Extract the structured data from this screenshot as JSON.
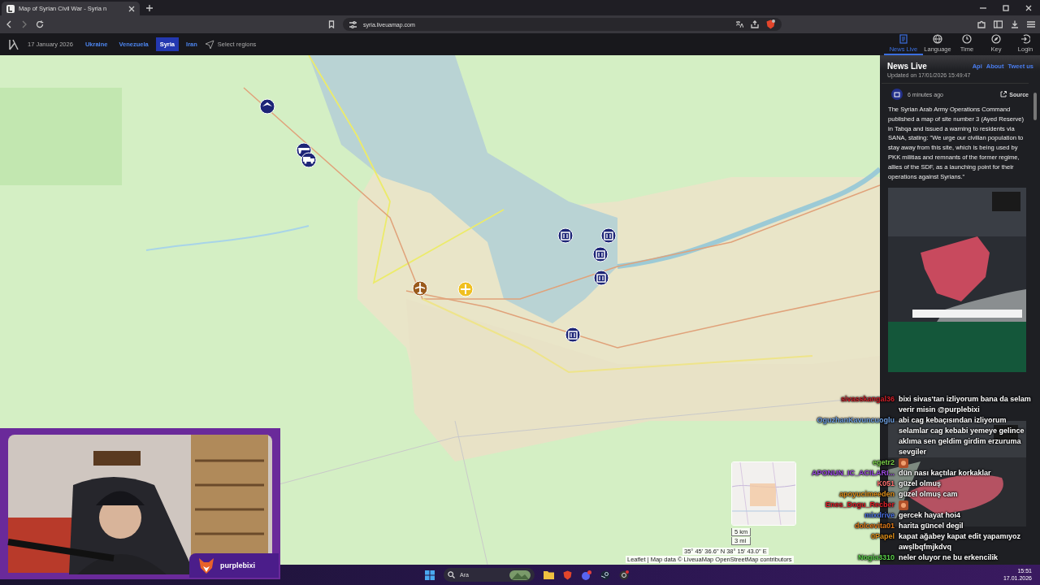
{
  "browser": {
    "tab": {
      "title": "Map of Syrian Civil War - Syria n",
      "selected": true
    },
    "url": "syria.liveuamap.com"
  },
  "site_nav": {
    "date": "17 January 2026",
    "regions": [
      {
        "label": "Ukraine",
        "selected": false
      },
      {
        "label": "Venezuela",
        "selected": false
      },
      {
        "label": "Syria",
        "selected": true
      },
      {
        "label": "Iran",
        "selected": false
      }
    ],
    "select_regions": "Select regions",
    "tools": [
      {
        "label": "News Live",
        "kind": "news",
        "selected": true
      },
      {
        "label": "Language",
        "kind": "language",
        "selected": false
      },
      {
        "label": "Time",
        "kind": "time",
        "selected": false
      },
      {
        "label": "Key",
        "kind": "key",
        "selected": false
      },
      {
        "label": "Login",
        "kind": "login",
        "selected": false
      }
    ]
  },
  "map": {
    "markers": [
      {
        "kind": "plane"
      },
      {
        "kind": "gun"
      },
      {
        "kind": "truck"
      },
      {
        "kind": "building"
      },
      {
        "kind": "building"
      },
      {
        "kind": "building"
      },
      {
        "kind": "building"
      },
      {
        "kind": "building"
      },
      {
        "kind": "airport"
      },
      {
        "kind": "control"
      }
    ],
    "coordinates": "35° 45' 36.6\" N 38° 15' 43.0\" E",
    "scale": [
      "5 km",
      "3 mi"
    ],
    "attribution": "Leaflet | Map data © LiveuaMap OpenStreetMap contributors"
  },
  "news_panel": {
    "title": "News Live",
    "links": [
      "Api",
      "About",
      "Tweet us"
    ],
    "updated": "Updated on 17/01/2026 15:49:47",
    "items": [
      {
        "time": "6 minutes ago",
        "source": "Source",
        "text": "The Syrian Arab Army Operations Command published a map of site number 3 (Ayed Reserve) in Tabqa and issued a warning to residents via SANA, stating: \"We urge our civilian population to stay away from this site, which is being used by PKK militias and remnants of the former regime, allies of the SDF, as a launching point for their operations against Syrians.\""
      }
    ]
  },
  "webcam": {
    "kind": "picture",
    "channel": "purplebixi"
  },
  "chat": [
    {
      "user": "sivasskangal36",
      "color": "#d0202a",
      "kind": "text",
      "message": "bixi sivas'tan izliyorum bana da selam verir misin @purplebixi"
    },
    {
      "user": "OguzhanKavuncuoglu",
      "color": "#6fa0e0",
      "kind": "text",
      "message": "abi cag kebaçısından izliyorum selamlar cag kebabi yemeye gelince aklıma sen geldim girdim erzuruma sevgiler"
    },
    {
      "user": "egetr2",
      "color": "#7ad04a",
      "kind": "emote"
    },
    {
      "user": "APONUN_IC_ACILARI...",
      "color": "#9a4ae0",
      "kind": "text",
      "message": "dün nası kaçtılar korkaklar"
    },
    {
      "user": "K051",
      "color": "#ff7070",
      "kind": "text",
      "message": "güzel olmuş"
    },
    {
      "user": "apoyucimeeden",
      "color": "#e0901a",
      "kind": "text",
      "message": "güzel olmuş cam"
    },
    {
      "user": "Enes_Dogu_Recber",
      "color": "#e0202a",
      "kind": "emote"
    },
    {
      "user": "mixdrive",
      "color": "#4a70e0",
      "kind": "text",
      "message": "gercek hayat hoi4"
    },
    {
      "user": "dolcevita01",
      "color": "#e07a1a",
      "kind": "text",
      "message": "harita güncel degil"
    },
    {
      "user": "0Papel",
      "color": "#e0901a",
      "kind": "text",
      "message": "kapat ağabey kapat edit yapamıyoz awşlbqfmjkdvq"
    },
    {
      "user": "Nogia3310",
      "color": "#5ad04a",
      "kind": "text",
      "message": "neler oluyor ne bu erkencilik"
    }
  ],
  "taskbar": {
    "search": "Ara",
    "time": "15:51",
    "date": "17.01.2026"
  }
}
